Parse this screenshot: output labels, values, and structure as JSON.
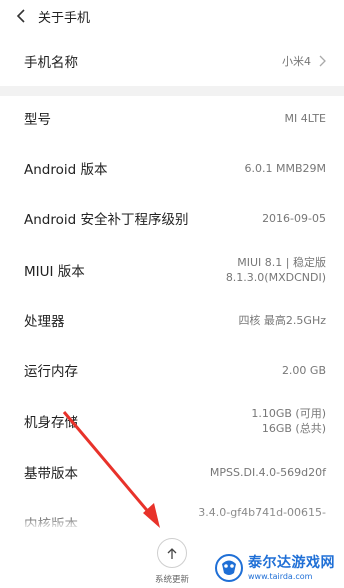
{
  "header": {
    "title": "关于手机"
  },
  "rows": [
    {
      "label": "手机名称",
      "value": "小米4"
    },
    {
      "label": "型号",
      "value": "MI 4LTE"
    },
    {
      "label": "Android 版本",
      "value": "6.0.1 MMB29M"
    },
    {
      "label": "Android 安全补丁程序级别",
      "value": "2016-09-05"
    },
    {
      "label": "MIUI 版本",
      "value_line1": "MIUI 8.1 | 稳定版",
      "value_line2": "8.1.3.0(MXDCNDI)"
    },
    {
      "label": "处理器",
      "value": "四核 最高2.5GHz"
    },
    {
      "label": "运行内存",
      "value": "2.00 GB"
    },
    {
      "label": "机身存储",
      "value_line1": "1.10GB (可用)",
      "value_line2": "16GB (总共)"
    },
    {
      "label": "基带版本",
      "value": "MPSS.DI.4.0-569d20f"
    },
    {
      "label": "内核版本",
      "value": "3.4.0-gf4b741d-00615-"
    }
  ],
  "bottom": {
    "update_label": "系统更新"
  },
  "watermark": {
    "title": "泰尔达游戏网",
    "url": "www.tairda.com"
  },
  "colors": {
    "accent": "#1f6fd6",
    "arrow": "#e8322a",
    "divider": "#f2f2f2"
  }
}
